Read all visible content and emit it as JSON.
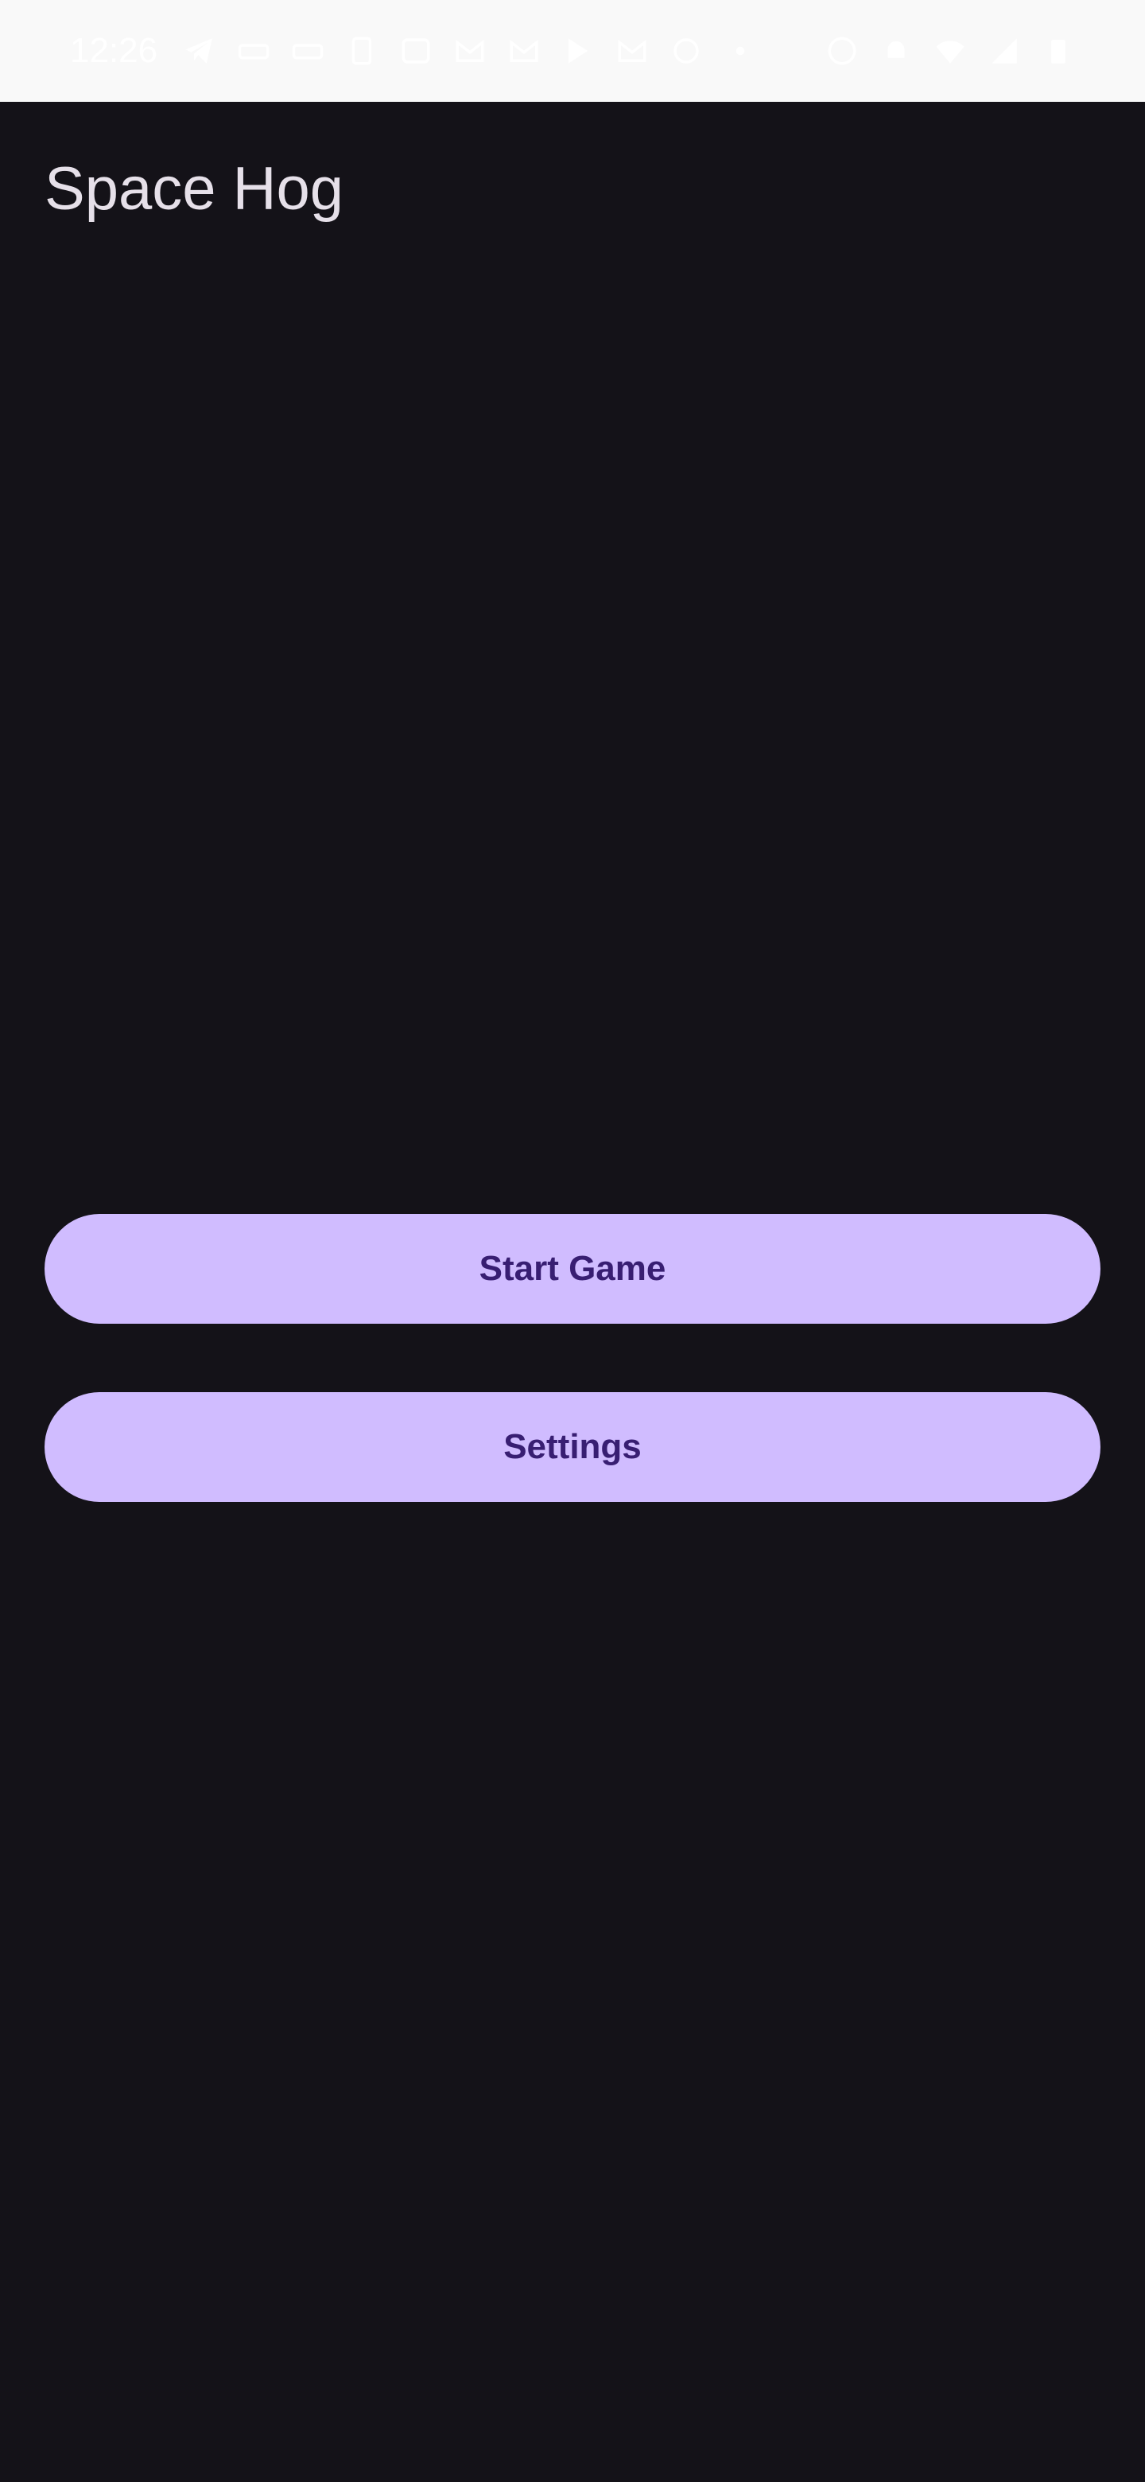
{
  "status_bar": {
    "time": "12:26",
    "left_icons": [
      "telegram-icon",
      "tag-icon",
      "tag-icon",
      "sim-icon",
      "sync-icon",
      "gmail-icon",
      "gmail-icon",
      "play-icon",
      "gmail-icon",
      "pinwheel-icon",
      "dot-icon"
    ],
    "right_icons": [
      "smiley-icon",
      "bell-off-icon",
      "wifi-icon",
      "signal-icon",
      "battery-icon"
    ]
  },
  "app": {
    "title": "Space Hog",
    "start_button_label": "Start Game",
    "settings_button_label": "Settings"
  },
  "colors": {
    "background": "#141218",
    "title_text": "#e6e0e9",
    "button_bg": "#d0bcff",
    "button_text": "#381e72",
    "status_bar_bg": "#f9f9f9"
  }
}
